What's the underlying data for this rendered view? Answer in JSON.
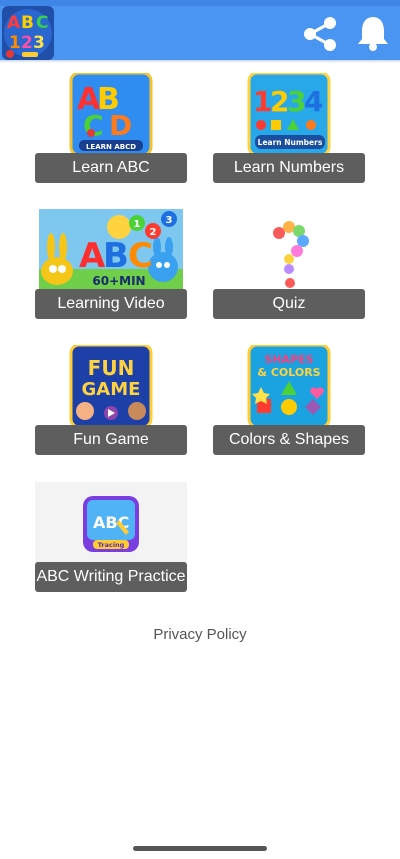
{
  "appbar": {
    "logo_icon": "abc-123-logo-icon",
    "share_icon": "share-icon",
    "notification_icon": "bell-icon",
    "color": "#4a95f2"
  },
  "tiles": [
    {
      "label": "Learn ABC",
      "thumb_icon": "learn-abc-app-icon",
      "thumb_caption": "LEARN ABCD"
    },
    {
      "label": "Learn Numbers",
      "thumb_icon": "learn-numbers-app-icon",
      "thumb_caption": "Learn Numbers"
    },
    {
      "label": "Learning Video",
      "thumb_icon": "learning-video-banner",
      "thumb_caption": "60+MIN"
    },
    {
      "label": "Quiz",
      "thumb_icon": "question-mark-balloons-icon"
    },
    {
      "label": "Fun Game",
      "thumb_icon": "fun-game-app-icon"
    },
    {
      "label": "Colors & Shapes",
      "thumb_icon": "shapes-colors-app-icon"
    },
    {
      "label": "ABC Writing Practice",
      "thumb_icon": "abc-tracing-app-icon",
      "thumb_caption": "Tracing"
    }
  ],
  "privacy_policy": "Privacy Policy",
  "label_color": "#5e5e5e"
}
